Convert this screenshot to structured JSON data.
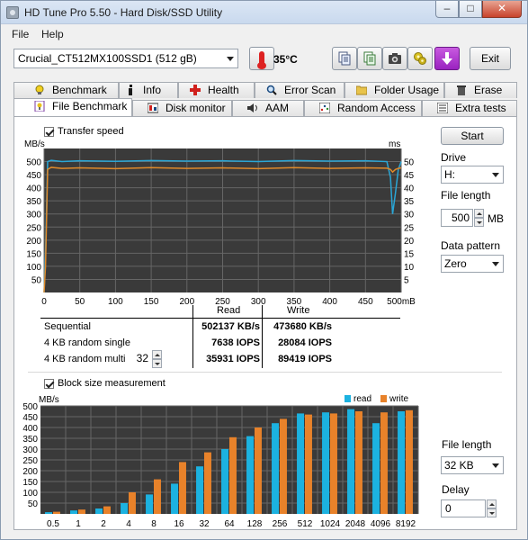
{
  "window": {
    "title": "HD Tune Pro 5.50 - Hard Disk/SSD Utility",
    "min": "–",
    "max": "□",
    "close": "✕"
  },
  "menu": [
    {
      "label": "File"
    },
    {
      "label": "Help"
    }
  ],
  "toolbar": {
    "drive": "Crucial_CT512MX100SSD1 (512 gB)",
    "temperature": "35°C",
    "exit_label": "Exit",
    "icons": [
      "copy-text-icon",
      "copy-info-icon",
      "camera-icon",
      "options-icon",
      "save-download-icon"
    ]
  },
  "tabs_top": [
    "Benchmark",
    "Info",
    "Health",
    "Error Scan",
    "Folder Usage",
    "Erase"
  ],
  "tabs_bottom": [
    "File Benchmark",
    "Disk monitor",
    "AAM",
    "Random Access",
    "Extra tests"
  ],
  "transfer": {
    "checkbox_label": "Transfer speed",
    "y_left_unit": "MB/s",
    "y_right_unit": "ms",
    "x_unit_suffix": "mB",
    "y_left_ticks": [
      500,
      450,
      400,
      350,
      300,
      250,
      200,
      150,
      100,
      50
    ],
    "y_right_ticks": [
      50,
      45,
      40,
      35,
      30,
      25,
      20,
      15,
      10,
      5
    ],
    "x_ticks": [
      "0",
      "50",
      "100",
      "150",
      "200",
      "250",
      "300",
      "350",
      "400",
      "450",
      "500"
    ]
  },
  "results": {
    "col_read": "Read",
    "col_write": "Write",
    "rows": [
      {
        "label": "Sequential",
        "read": "502137 KB/s",
        "write": "473680 KB/s"
      },
      {
        "label": "4 KB random single",
        "read": "7638 IOPS",
        "write": "28084 IOPS"
      },
      {
        "label": "4 KB random multi",
        "read": "35931 IOPS",
        "write": "89419 IOPS",
        "queue": "32"
      }
    ]
  },
  "block": {
    "checkbox_label": "Block size measurement",
    "y_unit": "MB/s",
    "legend_read": "read",
    "legend_write": "write"
  },
  "right_panel": {
    "start_label": "Start",
    "drive_label": "Drive",
    "drive_value": "H:",
    "file_length_label": "File length",
    "file_length_value": "500",
    "file_length_unit": "MB",
    "pattern_label": "Data pattern",
    "pattern_value": "Zero",
    "block_file_length_label": "File length",
    "block_file_length_value": "32 KB",
    "delay_label": "Delay",
    "delay_value": "0"
  },
  "colors": {
    "chart_bg": "#3a3a3a",
    "grid": "#666666",
    "read_line": "#2aa6d6",
    "write_line": "#e08a2a",
    "read_bar": "#1cb2e0",
    "write_bar": "#e8822a",
    "accent_purple": "#b02bd4"
  },
  "chart_data": [
    {
      "type": "line",
      "title": "Transfer speed",
      "xlabel": "mB",
      "ylabel": "MB/s",
      "xlim": [
        0,
        500
      ],
      "ylim": [
        0,
        550
      ],
      "x": [
        0,
        2,
        5,
        10,
        25,
        50,
        100,
        150,
        200,
        250,
        300,
        350,
        400,
        450,
        480,
        485,
        488,
        492,
        496,
        500
      ],
      "series": [
        {
          "name": "read",
          "values": [
            0,
            150,
            500,
            505,
            500,
            503,
            501,
            504,
            502,
            503,
            500,
            504,
            502,
            503,
            500,
            440,
            300,
            380,
            470,
            500
          ]
        },
        {
          "name": "write",
          "values": [
            0,
            100,
            470,
            478,
            474,
            476,
            473,
            477,
            474,
            476,
            473,
            477,
            474,
            476,
            475,
            470,
            460,
            470,
            474,
            476
          ]
        }
      ],
      "grid": true
    },
    {
      "type": "bar",
      "title": "Block size measurement",
      "ylabel": "MB/s",
      "ylim": [
        0,
        500
      ],
      "categories": [
        "0.5",
        "1",
        "2",
        "4",
        "8",
        "16",
        "32",
        "64",
        "128",
        "256",
        "512",
        "1024",
        "2048",
        "4096",
        "8192"
      ],
      "series": [
        {
          "name": "read",
          "values": [
            8,
            16,
            25,
            50,
            90,
            140,
            220,
            300,
            360,
            420,
            465,
            470,
            485,
            420,
            475
          ]
        },
        {
          "name": "write",
          "values": [
            10,
            20,
            35,
            100,
            160,
            240,
            285,
            355,
            400,
            440,
            460,
            465,
            475,
            470,
            480
          ]
        }
      ],
      "legend": "top-right",
      "grid": true
    }
  ]
}
